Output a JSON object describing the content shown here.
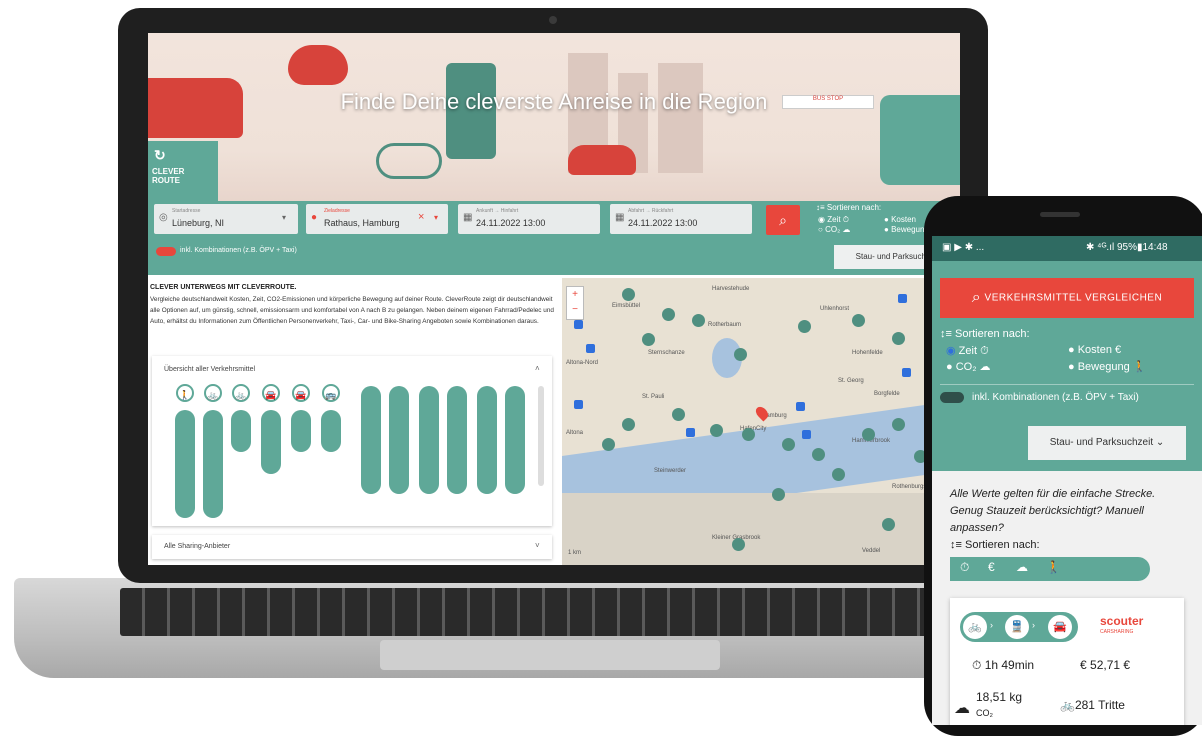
{
  "desktop": {
    "hero_title": "Finde Deine cleverste Anreise in die Region",
    "logo_text": "CLEVER ROUTE",
    "search": {
      "start_label": "Startadresse",
      "start_value": "Lüneburg, NI",
      "dest_label": "Zieladresse",
      "dest_value": "Rathaus, Hamburg",
      "arrival_label": "Ankunft → Hinfahrt",
      "arrival_value": "24.11.2022 13:00",
      "departure_label": "Abfahrt → Rückfahrt",
      "departure_value": "24.11.2022 13:00",
      "sort_label": "Sortieren nach:",
      "sort_time": "Zeit",
      "sort_cost": "Kosten",
      "sort_co2": "CO₂",
      "sort_move": "Bewegung",
      "combo_toggle": "inkl. Kombinationen (z.B. ÖPV + Taxi)",
      "stau_button": "Stau- und Parksuchzeit"
    },
    "intro_title": "CLEVER UNTERWEGS MIT CLEVERROUTE.",
    "intro_text": "Vergleiche deutschlandweit Kosten, Zeit, CO2-Emissionen und körperliche Bewegung auf deiner Route. CleverRoute zeigt dir deutschlandweit alle Optionen auf, um günstig, schnell, emissionsarm und komfortabel von A nach B zu gelangen. Neben deinem eigenen Fahrrad/Pedelec und Auto, erhältst du Informationen zum Öffentlichen Personenverkehr, Taxi-, Car- und Bike-Sharing Angeboten sowie Kombinationen daraus.",
    "overview_title": "Übersicht aller Verkehrsmittel",
    "sharing_title": "Alle Sharing-Anbieter",
    "map_labels": [
      "Eimsbüttel",
      "Harvestehude",
      "Uhlenhorst",
      "Rotherbaum",
      "Hohenfelde",
      "Altona-Nord",
      "Sternschanze",
      "St. Georg",
      "St. Pauli",
      "Borgfelde",
      "Altona",
      "Hamburg",
      "HafenCity",
      "Hammerbrook",
      "Steinwerder",
      "Rothenburgsort",
      "Kleiner Grasbrook",
      "Veddel",
      "1 km"
    ],
    "map_zoom_in": "+",
    "map_zoom_out": "−"
  },
  "mobile": {
    "status_left": "▣ ▶ ✱ ...",
    "status_right": "✱ ⁴ᴳ.ıl 95%▮14:48",
    "compare_button": "VERKEHRSMITTEL VERGLEICHEN",
    "sort_label": "Sortieren nach:",
    "sort_time": "Zeit",
    "sort_cost": "Kosten",
    "sort_co2": "CO₂",
    "sort_move": "Bewegung",
    "combo_toggle": "inkl. Kombinationen (z.B. ÖPV + Taxi)",
    "stau_button": "Stau- und Parksuchzeit",
    "note": "Alle Werte gelten für die einfache Strecke. Genug Stauzeit berücksichtigt? Manuell anpassen?",
    "sort_label2": "Sortieren nach:",
    "card": {
      "provider": "scouter",
      "provider_sub": "CARSHARING",
      "duration": "1h 49min",
      "cost": "52,71 €",
      "co2_value": "18,51 kg",
      "co2_unit": "CO₂",
      "steps": "281 Tritte"
    }
  },
  "colors": {
    "teal": "#5fa898",
    "red": "#e8473c",
    "dark_teal": "#2f6b62"
  }
}
